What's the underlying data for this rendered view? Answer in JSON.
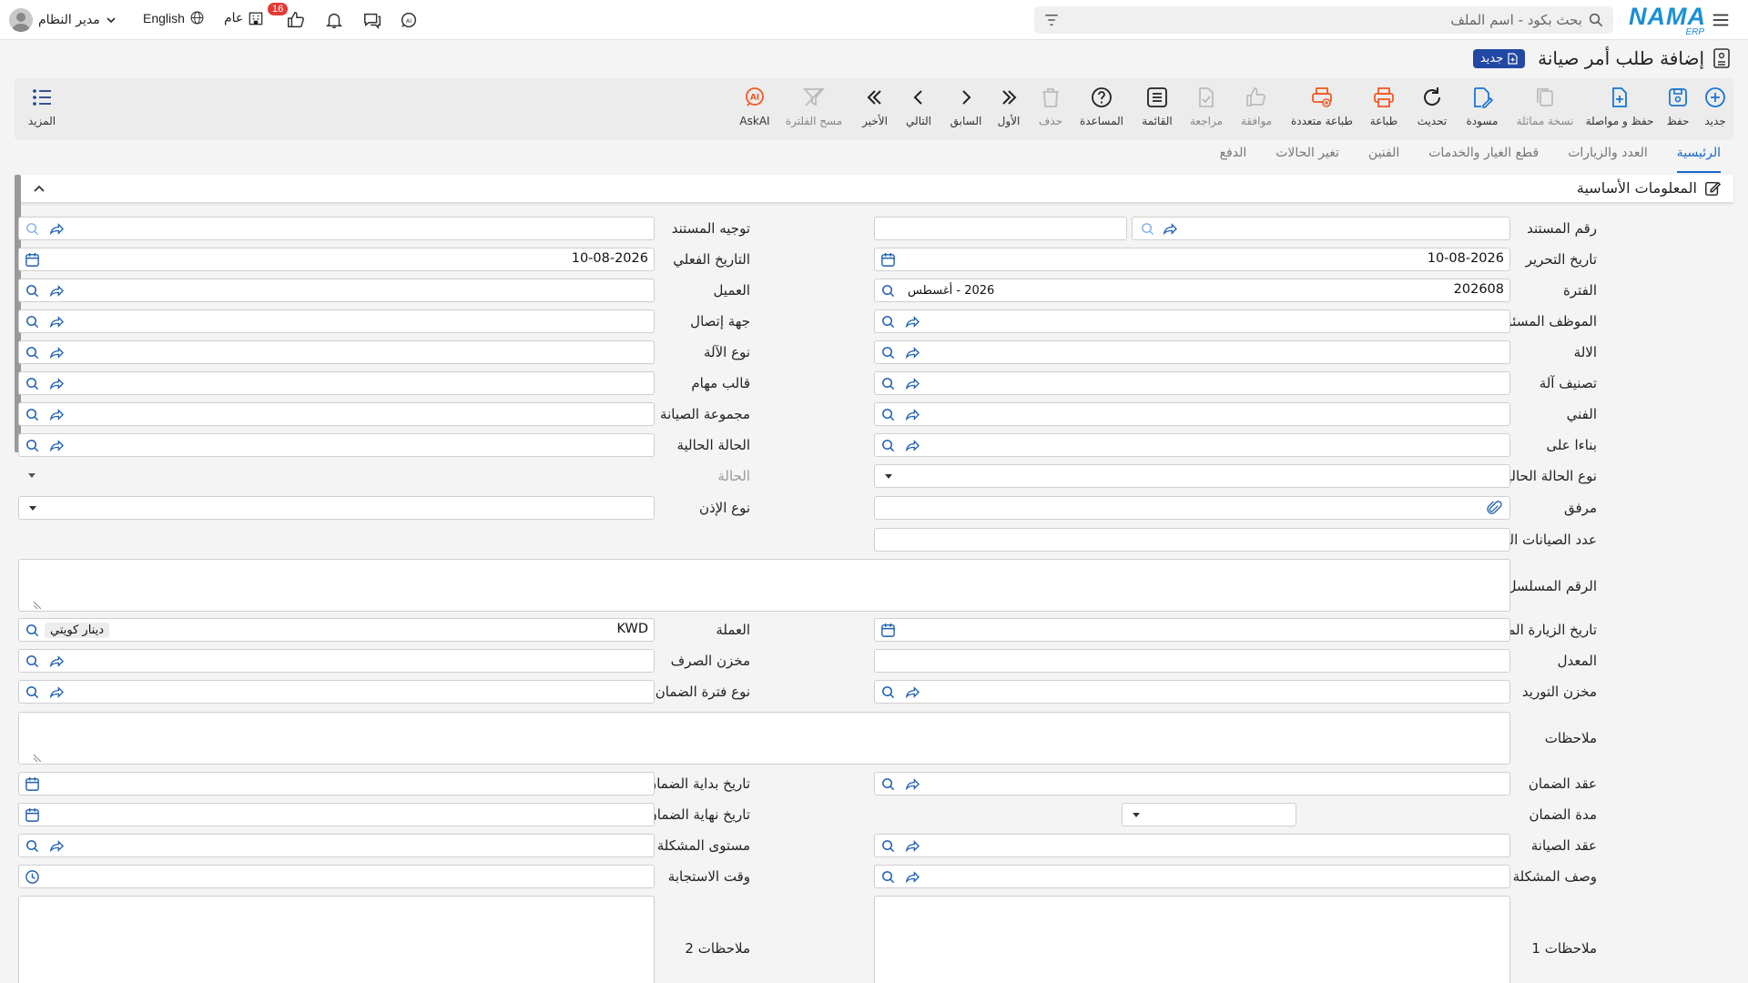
{
  "header": {
    "logo_main": "NAMA",
    "logo_sub": "ERP",
    "search_placeholder": "بحث بكود - اسم الملف",
    "user_name": "مدير النظام",
    "language": "English",
    "general_label": "عام",
    "notification_count": "16"
  },
  "page": {
    "title": "إضافة طلب أمر صيانة",
    "status_badge": "جديد"
  },
  "toolbar": {
    "new": "جديد",
    "save": "حفظ",
    "save_continue": "حفظ و مواصلة",
    "copy": "نسخة مماثلة",
    "draft": "مسودة",
    "refresh": "تحديث",
    "print": "طباعة",
    "multi_print": "طباعة متعددة",
    "approve": "موافقة",
    "review": "مراجعة",
    "list": "القائمة",
    "help": "المساعدة",
    "delete": "حذف",
    "first": "الأول",
    "previous": "السابق",
    "next": "التالي",
    "last": "الأخير",
    "clear_filter": "مسح الفلترة",
    "askai": "AskAI",
    "more": "المزيد"
  },
  "tabs": [
    "الرئيسية",
    "العدد والزيارات",
    "قطع الغيار والخدمات",
    "الفنين",
    "تغير الحالات",
    "الدفع"
  ],
  "section": {
    "title": "المعلومات الأساسية"
  },
  "form": {
    "labels": {
      "doc_number": "رقم المستند",
      "doc_direction": "توجيه المستند",
      "edit_date": "تاريخ التحرير",
      "actual_date": "التاريخ الفعلي",
      "period": "الفترة",
      "customer": "العميل",
      "employee": "الموظف المسئول",
      "contact": "جهة إتصال",
      "machine": "الالة",
      "machine_type": "نوع الآلة",
      "machine_class": "تصنيف آلة",
      "task_template": "قالب مهام",
      "technician": "الفني",
      "maint_group": "مجموعة الصيانة",
      "based_on": "بناءا على",
      "current_state": "الحالة الحالية",
      "current_state_type": "نوع الحالة الحالية",
      "state": "الحالة",
      "attachment": "مرفق",
      "permit_type": "نوع الإذن",
      "periodic_count": "عدد الصيانات الدورية",
      "serial": "الرقم المسلسل",
      "planned_visit": "تاريخ الزيارة المخطط",
      "currency": "العملة",
      "rate": "المعدل",
      "issue_store": "مخزن الصرف",
      "supply_store": "مخزن التوريد",
      "warranty_type": "نوع فترة الضمان",
      "notes": "ملاحظات",
      "warranty_contract": "عقد الضمان",
      "warranty_start": "تاريخ بداية الضمان",
      "warranty_period": "مدة الضمان",
      "warranty_end": "تاريخ نهاية الضمان",
      "maint_contract": "عقد الصيانة",
      "problem_level": "مستوى المشكلة",
      "problem_desc": "وصف المشكلة",
      "response_time": "وقت الاستجابة",
      "notes1": "ملاحظات 1",
      "notes2": "ملاحظات 2"
    },
    "values": {
      "edit_date": "10-08-2026",
      "actual_date": "10-08-2026",
      "period_code": "202608",
      "period_name": "2026 - أغسطس",
      "currency_code": "KWD",
      "currency_name": "دينار كويتي"
    }
  }
}
